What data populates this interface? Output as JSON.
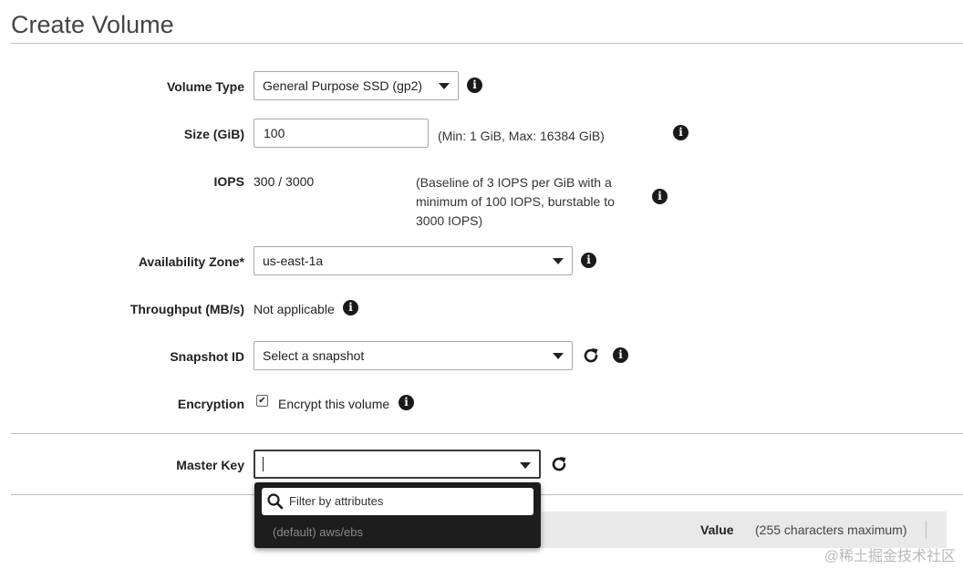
{
  "page": {
    "title": "Create Volume"
  },
  "form": {
    "volume_type": {
      "label": "Volume Type",
      "value": "General Purpose SSD (gp2)"
    },
    "size": {
      "label": "Size (GiB)",
      "value": "100",
      "hint": "(Min: 1 GiB, Max: 16384 GiB)"
    },
    "iops": {
      "label": "IOPS",
      "value": "300 / 3000",
      "hint_line1": "(Baseline of 3 IOPS per GiB with a",
      "hint_line2": "minimum of 100 IOPS, burstable to",
      "hint_line3": "3000 IOPS)"
    },
    "availability_zone": {
      "label": "Availability Zone*",
      "value": "us-east-1a"
    },
    "throughput": {
      "label": "Throughput (MB/s)",
      "value": "Not applicable"
    },
    "snapshot_id": {
      "label": "Snapshot ID",
      "value": "Select a snapshot"
    },
    "encryption": {
      "label": "Encryption",
      "checkbox_label": "Encrypt this volume",
      "checked": true
    },
    "master_key": {
      "label": "Master Key",
      "value": "",
      "dropdown": {
        "filter_placeholder": "Filter by attributes",
        "options": [
          "(default) aws/ebs"
        ]
      }
    }
  },
  "tags_table": {
    "value_header": "Value",
    "value_hint": "(255 characters maximum)"
  },
  "watermark": "@稀土掘金技术社区",
  "icons": {
    "info": "info-icon",
    "refresh": "refresh-icon",
    "search": "search-icon",
    "caret": "chevron-down-icon"
  },
  "colors": {
    "text": "#222222",
    "border": "#a9a9a9",
    "dropdown_bg": "#1d1d1d"
  }
}
